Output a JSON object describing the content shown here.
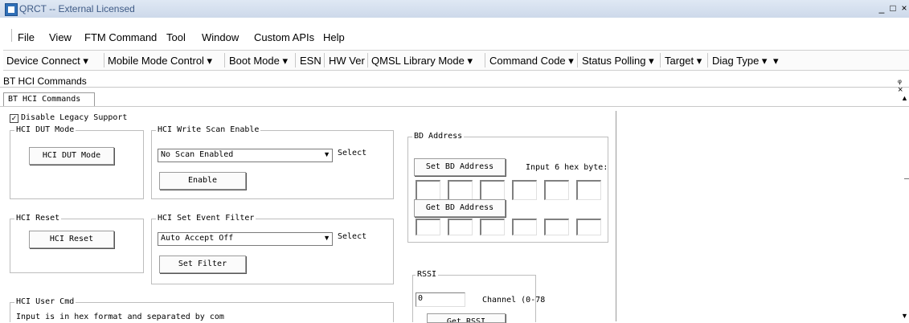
{
  "window": {
    "title": "QRCT -- External Licensed",
    "controls": [
      "_",
      "□",
      "×"
    ]
  },
  "menu": {
    "file": "File",
    "view": "View",
    "ftm_command": "FTM Command",
    "tool": "Tool",
    "window": "Window",
    "custom_apis": "Custom APIs",
    "help": "Help"
  },
  "toolbar": {
    "device_connect": "Device Connect ▾",
    "mobile_mode_control": "Mobile Mode Control ▾",
    "boot_mode": "Boot Mode ▾",
    "esn": "ESN",
    "hw_ver": "HW Ver",
    "qmsl_library_mode": "QMSL Library Mode ▾",
    "command_code": "Command Code ▾",
    "status_polling": "Status Polling ▾",
    "target": "Target ▾",
    "diag_type": "Diag Type ▾",
    "overflow": "▾"
  },
  "pane": {
    "title": "BT HCI Commands",
    "pin": "ᵩ ×"
  },
  "tab": {
    "label": "BT HCI Commands"
  },
  "legacy": {
    "checked": true,
    "label": "Disable Legacy Support"
  },
  "dut": {
    "group": "HCI DUT Mode",
    "button": "HCI DUT Mode"
  },
  "scan": {
    "group": "HCI Write Scan Enable",
    "selected": "No Scan Enabled",
    "select_label": "Select",
    "button": "Enable"
  },
  "reset": {
    "group": "HCI Reset",
    "button": "HCI Reset"
  },
  "event_filter": {
    "group": "HCI Set Event Filter",
    "selected": "Auto Accept Off",
    "select_label": "Select",
    "button": "Set Filter"
  },
  "bd": {
    "group": "BD Address",
    "set_button": "Set BD Address",
    "input_hint": "Input 6  hex byte:",
    "get_button": "Get BD Address"
  },
  "rssi": {
    "group": "RSSI",
    "channel_value": "0",
    "channel_label": "Channel (0-78",
    "button": "Get RSSI"
  },
  "user_cmd": {
    "group": "HCI User Cmd",
    "hint": "Input is in hex format and separated by com"
  }
}
